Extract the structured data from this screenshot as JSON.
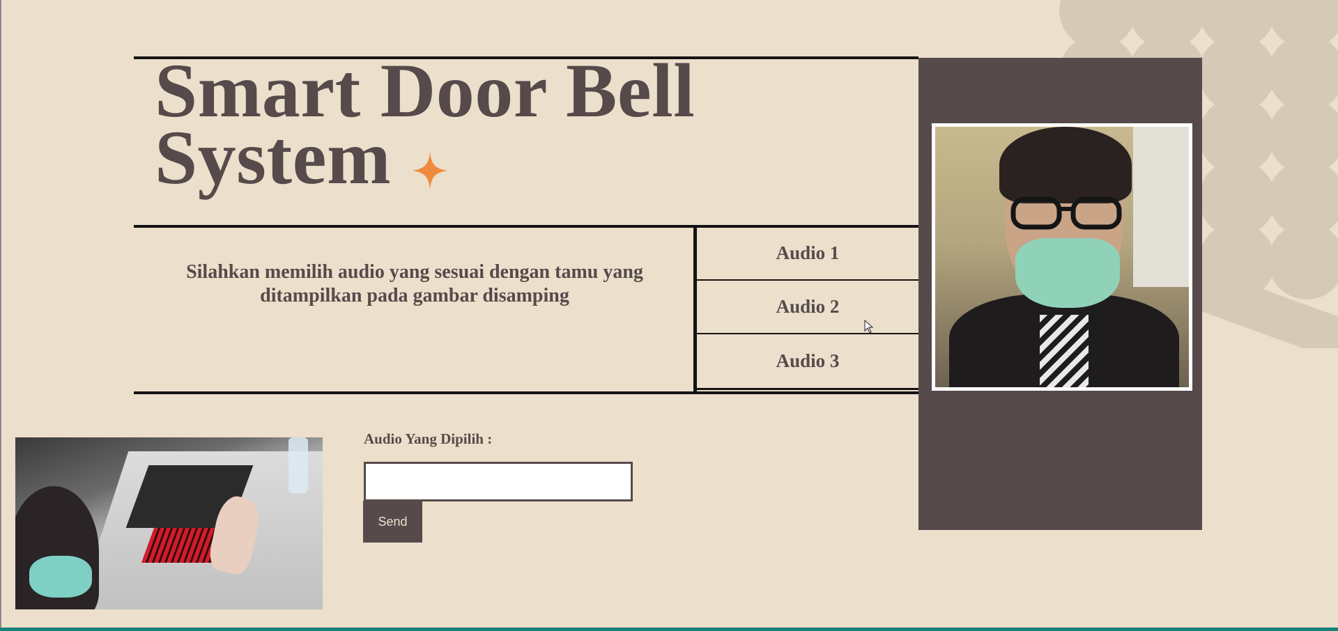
{
  "header": {
    "title_line1": "Smart Door Bell",
    "title_line2": "System",
    "sparkle_icon": "four-point-star-icon"
  },
  "instruction": {
    "text": "Silahkan memilih audio yang sesuai dengan tamu yang ditampilkan pada gambar disamping"
  },
  "audio_options": [
    {
      "label": "Audio 1"
    },
    {
      "label": "Audio 2"
    },
    {
      "label": "Audio 3"
    }
  ],
  "form": {
    "label": "Audio Yang Dipilih :",
    "input_value": "",
    "send_label": "Send"
  },
  "colors": {
    "background": "#ecdfcb",
    "primary": "#564a4b",
    "accent": "#f08a3c",
    "footer_bar": "#19807a"
  }
}
